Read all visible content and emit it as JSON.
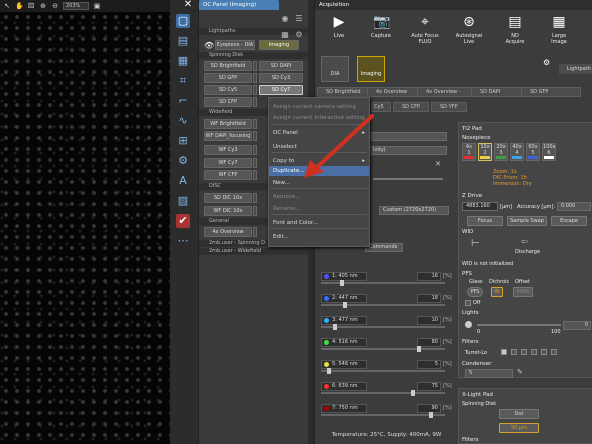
{
  "image_toolbar": {
    "zoom": "203%"
  },
  "oc_panel": {
    "tab_title": "OC Panel (Imaging)",
    "light_paths_label": "Lightpaths",
    "eyepiece_label": "Eyepiece - DIA",
    "imaging_label": "Imaging",
    "spinning_disk_label": "Spinning Disk",
    "widefield_label": "Widefield",
    "disc_label": "DISC",
    "general_label": "General",
    "buttons": {
      "sd_brightfield": "SD Brightfield",
      "sd_dapi": "SD DAPI",
      "sd_gfp": "SD GFP",
      "sd_cy3": "SD Cy3",
      "sd_cy5": "SD Cy5",
      "sd_cy7": "SD Cy7",
      "sd_cfp": "SD CFP",
      "wf_brightfield": "WF Brightfield",
      "wf_dapi": "WF DAPI_focusing",
      "wf_cy3": "WF Cy3",
      "wf_cy7": "WF Cy7",
      "wf_cfp": "WF CFP",
      "sd_dic_10x": "SD DIC 10x",
      "wf_dic_10x": "WF DIC 10x",
      "overview_4x": "4x Overview"
    },
    "user_rows": [
      "2mb.user - Spinning D",
      "2mb.user - Widefield"
    ]
  },
  "context_menu": {
    "items": [
      {
        "label": "Assign current camera setting",
        "disabled": true
      },
      {
        "label": "Assign current Interactive setting",
        "disabled": true
      },
      {
        "label": "OC Panel",
        "disabled": false,
        "submenu": true
      },
      {
        "label": "Unselect",
        "disabled": false
      },
      {
        "label": "Copy to",
        "disabled": false,
        "submenu": true
      },
      {
        "label": "Duplicate...",
        "disabled": false,
        "highlighted": true
      },
      {
        "label": "New...",
        "disabled": false
      },
      {
        "label": "Remove...",
        "disabled": true
      },
      {
        "label": "Rename...",
        "disabled": true
      },
      {
        "label": "Font and Color...",
        "disabled": false
      },
      {
        "label": "Edit...",
        "disabled": false
      }
    ]
  },
  "acquisition": {
    "title": "Acquisition",
    "buttons": [
      {
        "label": "Live",
        "icon": "play-icon"
      },
      {
        "label": "Capture",
        "icon": "camera-icon"
      },
      {
        "label": "Auto Focus\nFLUO",
        "icon": "autofocus-icon"
      },
      {
        "label": "Autosignal\nLive",
        "icon": "autosignal-icon"
      },
      {
        "label": "ND\nAcquire",
        "icon": "nd-acquire-icon"
      },
      {
        "label": "Large\nImage",
        "icon": "large-image-icon"
      }
    ],
    "modes": [
      {
        "label": "DIA",
        "active": false
      },
      {
        "label": "Imaging",
        "active": true
      }
    ],
    "lightpath_label": "Lightpath",
    "presets_row1": [
      "SD Brightfield",
      "4x Overview",
      "4x Overview -",
      "SD DAPI",
      "SD GFP"
    ],
    "presets_row2": [
      "Cy5",
      "SD CFP",
      "SD YFP"
    ],
    "camera_format": "Custom (2720x2720)",
    "commands_label": "Commands",
    "ti2_pad": {
      "title": "Ti2 Pad",
      "nosepiece_label": "Nosepiece",
      "objectives": [
        {
          "mag": "4x",
          "num": "1",
          "color": "#e03030"
        },
        {
          "mag": "10x",
          "num": "2",
          "color": "#e8d040"
        },
        {
          "mag": "20x",
          "num": "3",
          "color": "#40a040"
        },
        {
          "mag": "40x",
          "num": "4",
          "color": "#40a0e0"
        },
        {
          "mag": "60x",
          "num": "5",
          "color": "#4060e0"
        },
        {
          "mag": "100x",
          "num": "6",
          "color": "#ffffff"
        }
      ],
      "zoom_text": "Zoom: 1x",
      "dic_prism_text": "DIC Prism: 1h",
      "immersion_text": "Immersion: Dry",
      "zdrive_label": "Z Drive",
      "zdrive_value": "4883.160",
      "zdrive_unit": "[µm]",
      "accuracy_label": "Accuracy [µm]:",
      "accuracy_value": "0.000",
      "focus_label": "Focus",
      "sample_swap_label": "Sample Swap",
      "escape_label": "Escape",
      "wid_label": "WID",
      "discharge_label": "Discharge",
      "wid_status": "WID is not initialized",
      "pfs_label": "PFS",
      "glass_label": "Glass",
      "dichroic_label": "Dichroic",
      "offset_label": "Offset",
      "pfs_btn": "PFS",
      "in_btn": "IN",
      "off_label": "Off",
      "lights_label": "Lights",
      "lights_value": "0",
      "lights_min": "0",
      "lights_max": "100",
      "filters_label": "Filters",
      "turret_label": "Turret-Lo",
      "condenser_label": "Condenser",
      "condenser_value": "5"
    },
    "xlight": {
      "title": "X-Light Pad",
      "spinning_label": "Spinning Disk",
      "out_label": "Out",
      "pinhole_label": "50 µm",
      "filters_label": "Filters"
    },
    "channels": [
      {
        "label": "1: 405 nm",
        "value": "16",
        "unit": "[%]",
        "color": "#5050ff",
        "pos": 0.16
      },
      {
        "label": "2: 447 nm",
        "value": "18",
        "unit": "[%]",
        "color": "#3070ff",
        "pos": 0.18
      },
      {
        "label": "3: 477 nm",
        "value": "10",
        "unit": "[%]",
        "color": "#30b0ff",
        "pos": 0.1
      },
      {
        "label": "4: 516 nm",
        "value": "80",
        "unit": "[%]",
        "color": "#40e040",
        "pos": 0.8
      },
      {
        "label": "5: 546 nm",
        "value": "5",
        "unit": "[%]",
        "color": "#e0e040",
        "pos": 0.05
      },
      {
        "label": "6: 639 nm",
        "value": "75",
        "unit": "[%]",
        "color": "#ff3030",
        "pos": 0.75
      },
      {
        "label": "7: 750 nm",
        "value": "90",
        "unit": "[%]",
        "color": "#b00000",
        "pos": 0.9
      }
    ],
    "temperature": "Temperature: 25°C, Supply: 400mA, 9W"
  }
}
